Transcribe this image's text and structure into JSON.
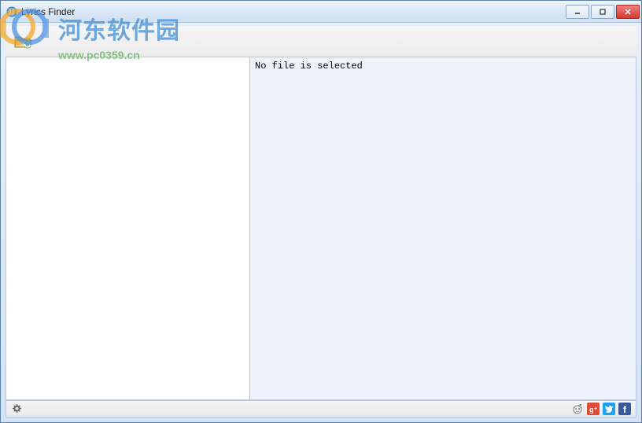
{
  "window": {
    "title": "Lyrics Finder"
  },
  "toolbar": {
    "open_folder_icon": "folder-open"
  },
  "content": {
    "status_message": "No file is selected"
  },
  "statusbar": {
    "settings_icon": "gear",
    "social": {
      "reddit": "reddit",
      "gplus": "g+",
      "twitter": "twitter",
      "facebook": "f"
    }
  },
  "watermark": {
    "text_cn": "河东软件园",
    "url": "www.pc0359.cn"
  }
}
